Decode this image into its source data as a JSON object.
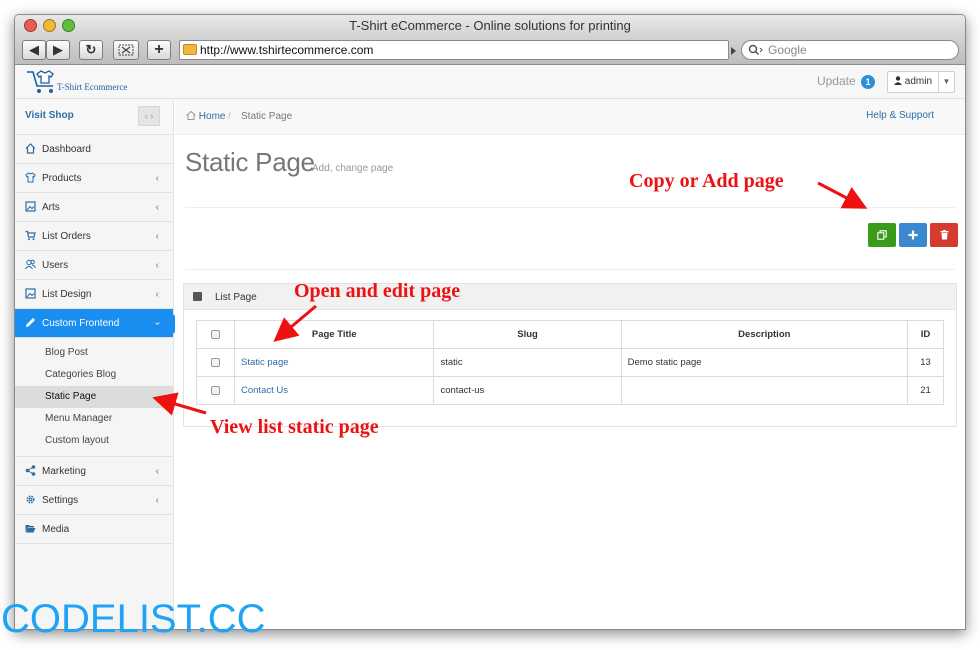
{
  "browser": {
    "title": "T-Shirt eCommerce - Online solutions for printing",
    "url": "http://www.tshirtecommerce.com",
    "search_placeholder": "Google",
    "back_glyph": "◀",
    "forward_glyph": "▶",
    "reload_glyph": "↻",
    "add_glyph": "+"
  },
  "header": {
    "brand": "T-Shirt Ecommerce",
    "update_label": "Update",
    "update_count": "1",
    "user": "admin"
  },
  "sidebar": {
    "visit_shop": "Visit Shop",
    "items": [
      {
        "label": "Dashboard",
        "icon": "home-icon"
      },
      {
        "label": "Products",
        "icon": "tshirt-icon"
      },
      {
        "label": "Arts",
        "icon": "image-icon"
      },
      {
        "label": "List Orders",
        "icon": "cart-icon"
      },
      {
        "label": "Users",
        "icon": "users-icon"
      },
      {
        "label": "List Design",
        "icon": "image-icon"
      },
      {
        "label": "Custom Frontend",
        "icon": "pencil-icon"
      },
      {
        "label": "Marketing",
        "icon": "share-icon"
      },
      {
        "label": "Settings",
        "icon": "gear-icon"
      },
      {
        "label": "Media",
        "icon": "folder-open-icon"
      }
    ],
    "sub_items": [
      "Blog Post",
      "Categories Blog",
      "Static Page",
      "Menu Manager",
      "Custom layout"
    ]
  },
  "breadcrumb": {
    "home": "Home",
    "current": "Static Page",
    "help": "Help & Support"
  },
  "page": {
    "title": "Static Page",
    "subtitle": "Add, change page"
  },
  "panel": {
    "title": "List Page",
    "columns": [
      "Page Title",
      "Slug",
      "Description",
      "ID"
    ],
    "rows": [
      {
        "title": "Static page",
        "slug": "static",
        "description": "Demo static page",
        "id": "13"
      },
      {
        "title": "Contact Us",
        "slug": "contact-us",
        "description": "",
        "id": "21"
      }
    ]
  },
  "annotations": {
    "copy_add": "Copy or Add page",
    "open_edit": "Open and edit page",
    "view_list": "View list static page"
  },
  "watermark": "CODELIST.CC",
  "colors": {
    "accent": "#1a8ef0",
    "copy_button": "#3a9a1a",
    "add_button": "#3a89d0",
    "delete_button": "#d33a30",
    "annotation": "#ee1111",
    "watermark": "#1ea3f5"
  }
}
